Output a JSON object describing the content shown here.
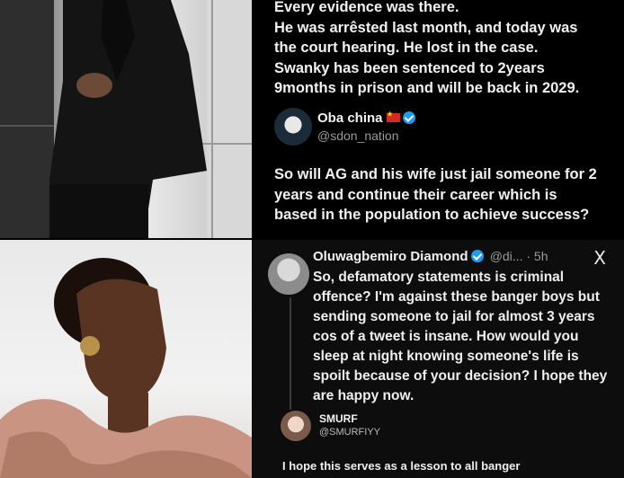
{
  "top_tweet": {
    "text": "Every evidence was there.\nHe was arrêsted last month, and today was\nthe court hearing. He lost in the case.\nSwanky has been sentenced to 2years\n9months in prison and will be back in 2029."
  },
  "quote": {
    "name": "Oba china",
    "handle": "@sdon_nation",
    "text": "So will AG and his wife just jail someone for 2\nyears and continue their career which is\nbased in the population to achieve success?"
  },
  "reply1": {
    "name": "Oluwagbemiro Diamond",
    "handle_time": "@di... · 5h",
    "x_icon": "X",
    "text": "So, defamatory statements is criminal\noffence? I'm against these banger boys but\nsending someone to jail for almost 3 years\ncos of a tweet is insane. How would you\nsleep at night knowing someone's life is\nspoilt because of your decision? I hope they\nare happy now."
  },
  "reply2": {
    "name": "SMURF",
    "handle": "@SMURFIYY",
    "text": "I hope this serves as a lesson to all banger"
  },
  "colors": {
    "verified": "#1d9bf0",
    "background": "#000000"
  },
  "icons": {
    "verified": "verified-badge-icon",
    "flag": "china-flag-icon",
    "x": "x-logo-icon"
  }
}
